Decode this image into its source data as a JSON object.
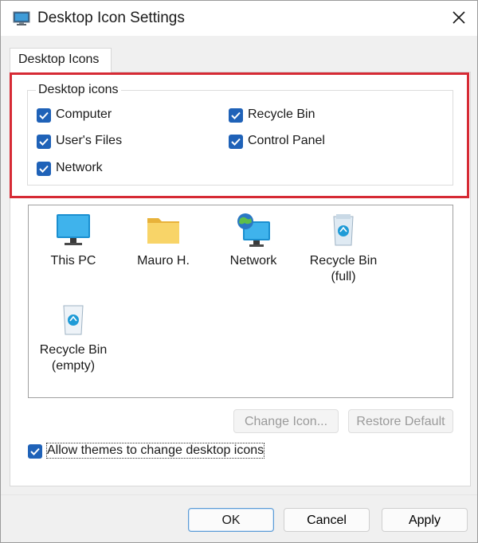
{
  "window": {
    "title": "Desktop Icon Settings"
  },
  "tab": {
    "label": "Desktop Icons"
  },
  "group": {
    "label": "Desktop icons",
    "checkboxes": [
      {
        "label": "Computer",
        "checked": true
      },
      {
        "label": "Recycle Bin",
        "checked": true
      },
      {
        "label": "User's Files",
        "checked": true
      },
      {
        "label": "Control Panel",
        "checked": true
      },
      {
        "label": "Network",
        "checked": true
      }
    ]
  },
  "icons": [
    {
      "caption": "This PC",
      "caption2": "",
      "icon": "monitor-icon"
    },
    {
      "caption": "Mauro H.",
      "caption2": "",
      "icon": "folder-icon"
    },
    {
      "caption": "Network",
      "caption2": "",
      "icon": "network-icon"
    },
    {
      "caption": "Recycle Bin",
      "caption2": "(full)",
      "icon": "recycle-bin-full-icon"
    },
    {
      "caption": "Recycle Bin",
      "caption2": "(empty)",
      "icon": "recycle-bin-empty-icon"
    }
  ],
  "buttons": {
    "change_icon": "Change Icon...",
    "restore_default": "Restore Default",
    "ok": "OK",
    "cancel": "Cancel",
    "apply": "Apply"
  },
  "themes_checkbox": {
    "label": "Allow themes to change desktop icons",
    "checked": true
  },
  "colors": {
    "accent": "#1f62b8",
    "highlight": "#d62a34"
  }
}
